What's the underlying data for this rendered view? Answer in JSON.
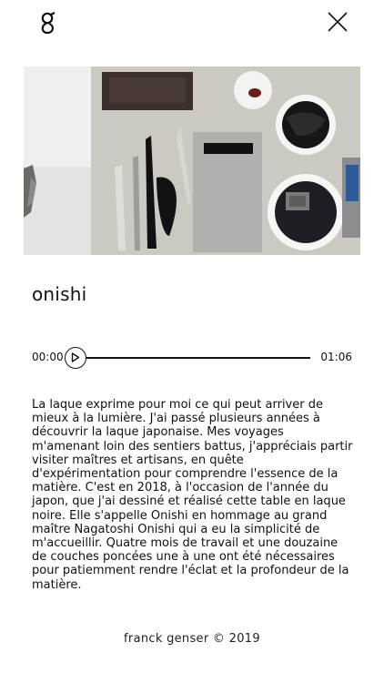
{
  "header": {
    "logo_icon": "g-logo-icon",
    "close_icon": "close-icon"
  },
  "carousel": {
    "images": [
      "prev-photo",
      "lacquer-tools-photo"
    ]
  },
  "track": {
    "title": "onishi"
  },
  "player": {
    "current_time": "00:00",
    "duration": "01:06",
    "progress": 0,
    "play_icon": "play-icon"
  },
  "description": "La laque exprime pour moi ce qui peut arriver de mieux à la lumière. J'ai passé plusieurs années à découvrir la laque japonaise. Mes voyages m'amenant loin des sentiers battus, j'appréciais partir visiter maîtres et artisans, en quête d'expérimentation pour comprendre l'essence de la matière. C'est en 2018, à l'occasion de l'année du japon, que j'ai dessiné et réalisé cette table en laque noire. Elle s'appelle Onishi en hommage au grand maître Nagatoshi Onishi qui a eu la simplicité de m'accueillir. Quatre mois de travail et une douzaine de couches poncées une à une ont été nécessaires pour patiemment rendre l'éclat et la profondeur de la matière.",
  "footer": {
    "text": "franck genser © 2019"
  }
}
